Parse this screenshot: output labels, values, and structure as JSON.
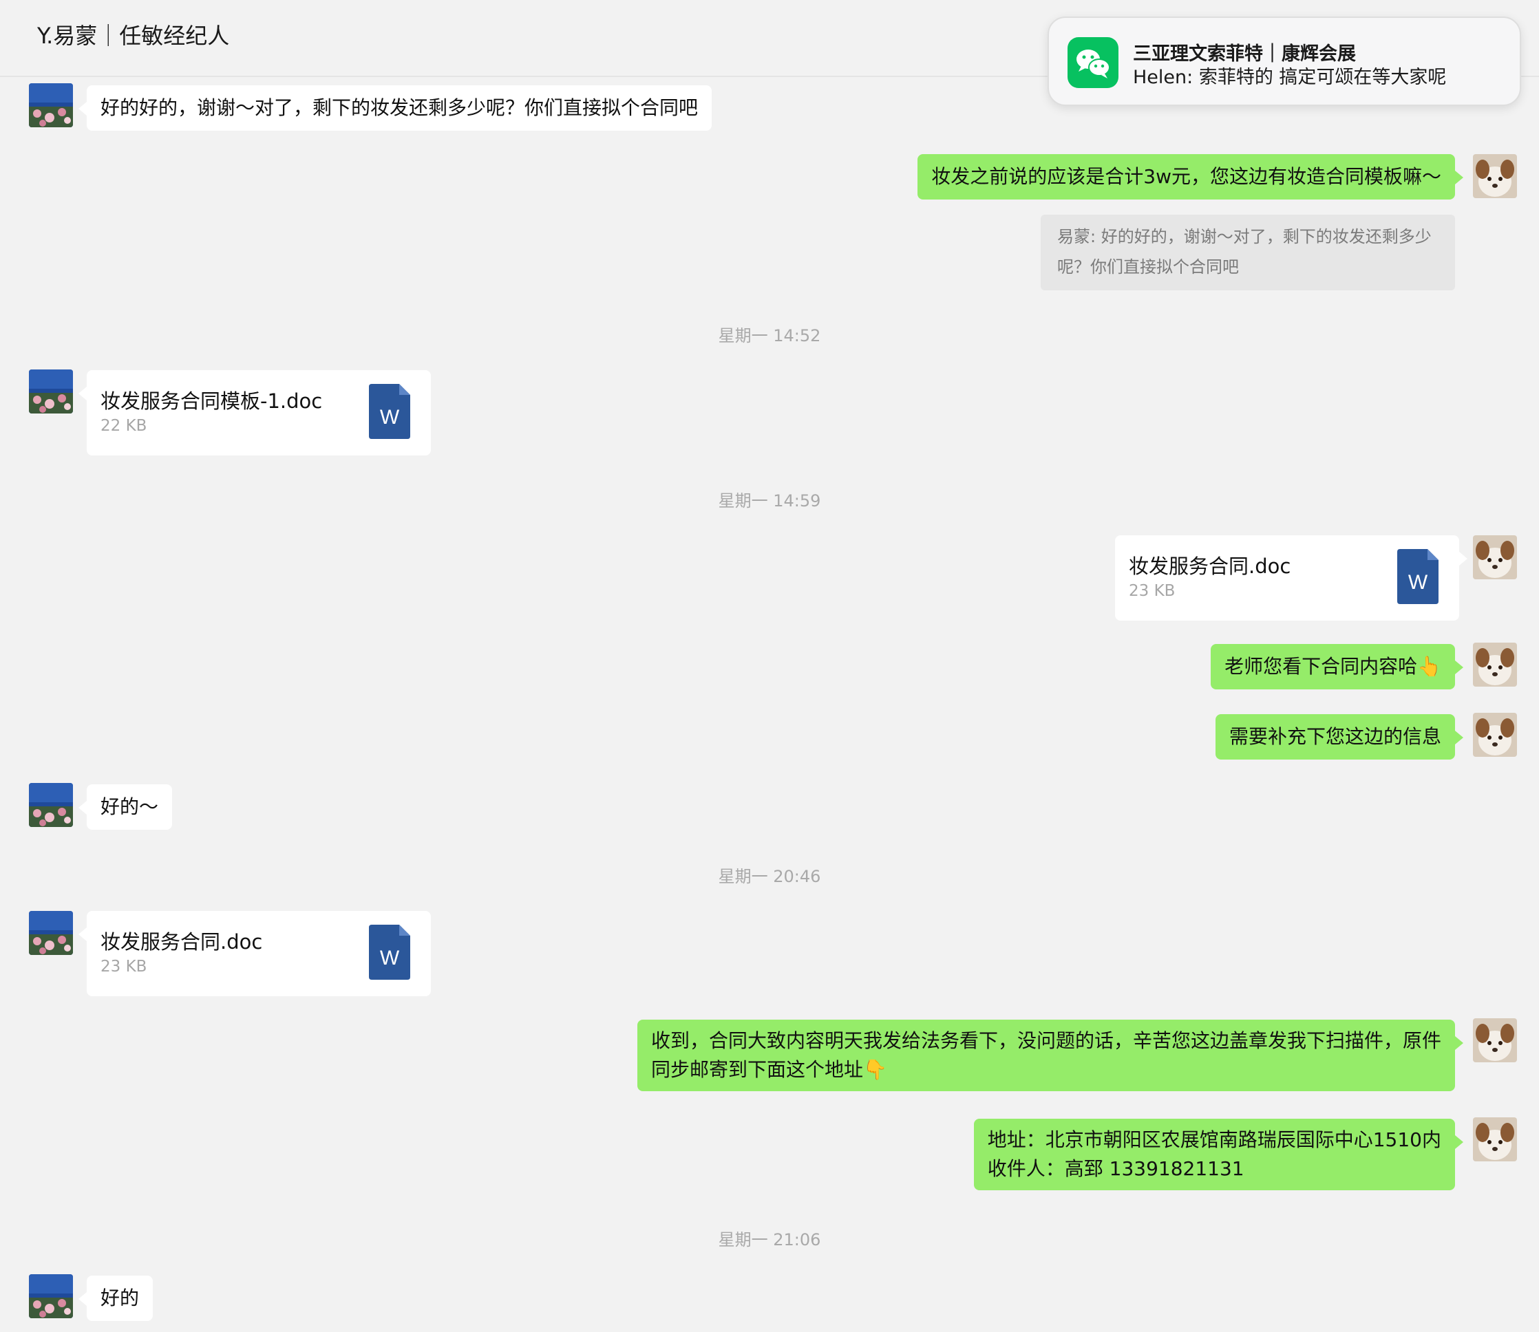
{
  "header": {
    "title": "Y.易蒙｜任敏经纪人"
  },
  "notification": {
    "app_icon": "wechat-icon",
    "title": "三亚理文索菲特｜康辉会展",
    "body": "Helen: 索菲特的 搞定可颂在等大家呢"
  },
  "messages": {
    "m1": {
      "text": "好的好的，谢谢～对了，剩下的妆发还剩多少呢？你们直接拟个合同吧"
    },
    "m2": {
      "text": "妆发之前说的应该是合计3w元，您这边有妆造合同模板嘛～",
      "quote_line1": "易蒙: 好的好的，谢谢～对了，剩下的妆发还剩多少",
      "quote_line2": "呢？你们直接拟个合同吧"
    },
    "t1": "星期一 14:52",
    "f1": {
      "name": "妆发服务合同模板-1.doc",
      "size": "22 KB",
      "icon_letter": "W"
    },
    "t2": "星期一 14:59",
    "f2": {
      "name": "妆发服务合同.doc",
      "size": "23 KB",
      "icon_letter": "W"
    },
    "m3": {
      "text": "老师您看下合同内容哈",
      "emoji": "👆"
    },
    "m4": {
      "text": "需要补充下您这边的信息"
    },
    "m5": {
      "text": "好的～"
    },
    "t3": "星期一 20:46",
    "f3": {
      "name": "妆发服务合同.doc",
      "size": "23 KB",
      "icon_letter": "W"
    },
    "m6": {
      "line1": "收到，合同大致内容明天我发给法务看下，没问题的话，辛苦您这边盖章发我下扫描件，原件",
      "line2": "同步邮寄到下面这个地址",
      "emoji": "👇"
    },
    "m7": {
      "line1": "地址：北京市朝阳区农展馆南路瑞辰国际中心1510内",
      "line2": "收件人：高郅 13391821131"
    },
    "t4": "星期一 21:06",
    "m8": {
      "text": "好的"
    }
  },
  "colors": {
    "outgoing_bubble": "#95ec69",
    "incoming_bubble": "#ffffff",
    "word_icon": "#2b579a",
    "wechat": "#07c160"
  }
}
